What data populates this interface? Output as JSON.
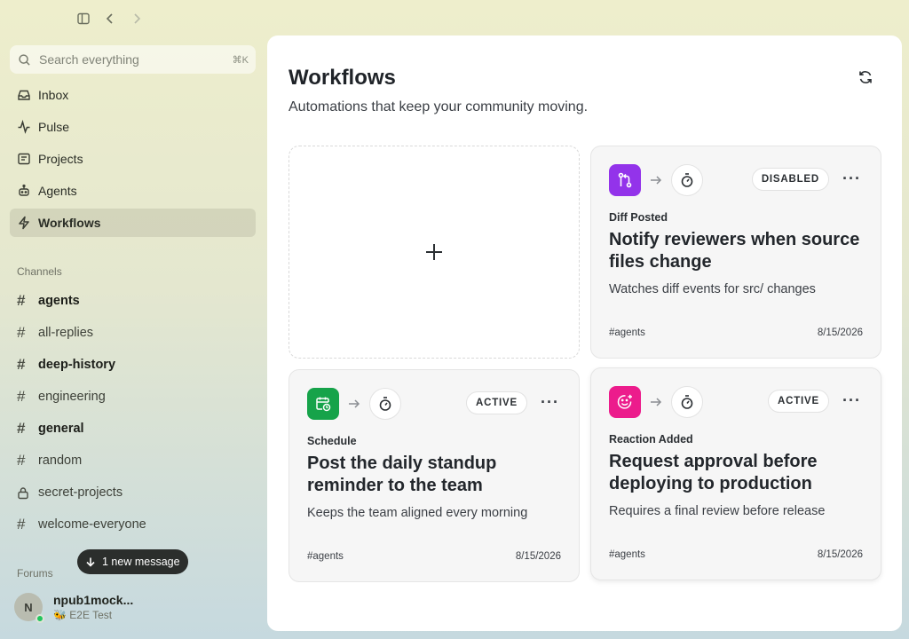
{
  "topbar": {
    "icons": [
      "sidebar-toggle-icon",
      "chevron-left-icon",
      "chevron-right-icon"
    ]
  },
  "search": {
    "placeholder": "Search everything",
    "shortcut": "⌘K"
  },
  "nav": [
    {
      "label": "Inbox",
      "icon": "inbox-icon"
    },
    {
      "label": "Pulse",
      "icon": "pulse-icon"
    },
    {
      "label": "Projects",
      "icon": "projects-icon"
    },
    {
      "label": "Agents",
      "icon": "agents-icon"
    },
    {
      "label": "Workflows",
      "icon": "workflows-icon",
      "active": true
    }
  ],
  "channels_label": "Channels",
  "channels": [
    {
      "name": "agents",
      "bold": true
    },
    {
      "name": "all-replies",
      "bold": false
    },
    {
      "name": "deep-history",
      "bold": true
    },
    {
      "name": "engineering",
      "bold": false
    },
    {
      "name": "general",
      "bold": true
    },
    {
      "name": "random",
      "bold": false
    },
    {
      "name": "secret-projects",
      "bold": false,
      "private": true
    },
    {
      "name": "welcome-everyone",
      "bold": false
    }
  ],
  "forums_label": "Forums",
  "new_message": "1 new message",
  "user": {
    "initial": "N",
    "name": "npub1mock...",
    "status": "🐝 E2E Test"
  },
  "main": {
    "title": "Workflows",
    "subtitle": "Automations that keep your community moving."
  },
  "cards": [
    {
      "trigger": "Diff Posted",
      "title": "Notify reviewers when source files change",
      "desc": "Watches diff events for src/ changes",
      "status": "DISABLED",
      "channel": "#agents",
      "date": "8/15/2026",
      "color": "#9333ea",
      "icon": "git-diff-icon"
    },
    {
      "trigger": "Schedule",
      "title": "Post the daily standup reminder to the team",
      "desc": "Keeps the team aligned every morning",
      "status": "ACTIVE",
      "channel": "#agents",
      "date": "8/15/2026",
      "color": "#16a34a",
      "icon": "calendar-clock-icon"
    },
    {
      "trigger": "Reaction Added",
      "title": "Request approval before deploying to production",
      "desc": "Requires a final review before release",
      "status": "ACTIVE",
      "channel": "#agents",
      "date": "8/15/2026",
      "color": "#ec1c8c",
      "icon": "smile-plus-icon"
    }
  ]
}
